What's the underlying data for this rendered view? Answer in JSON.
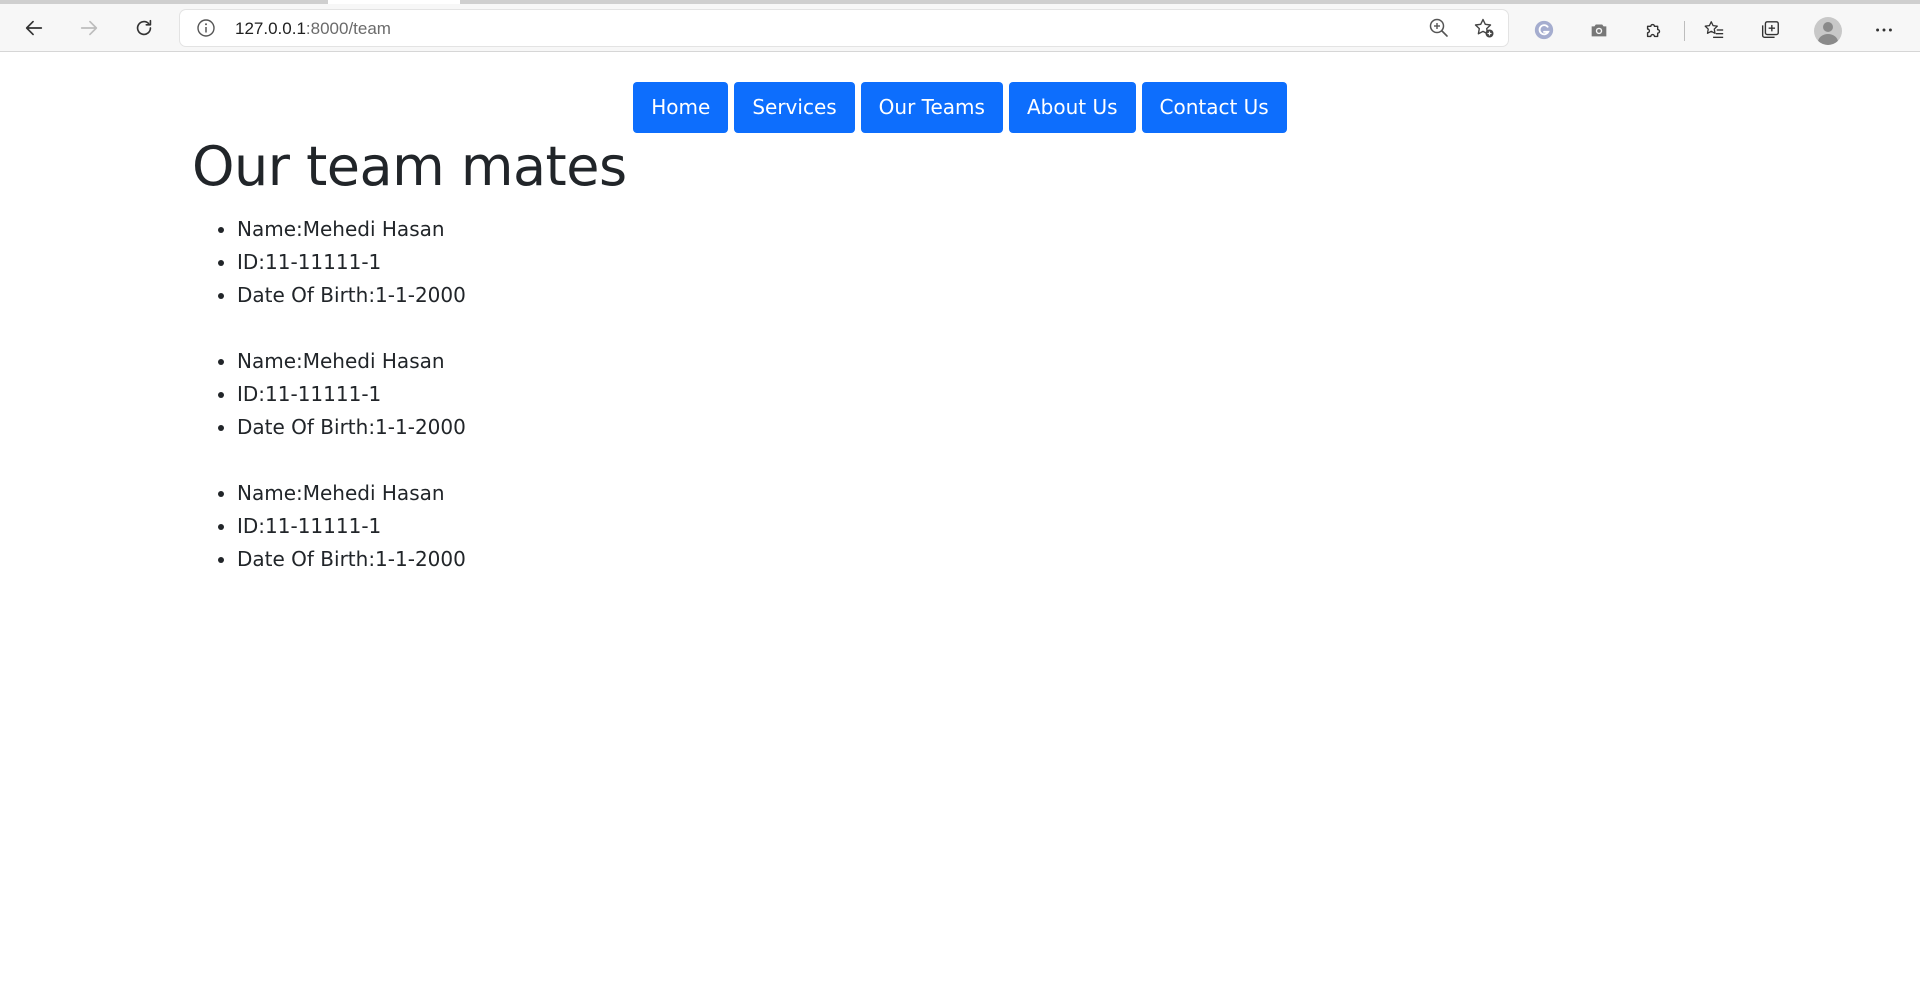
{
  "browser": {
    "url_host": "127.0.0.1",
    "url_rest": ":8000/team",
    "icons": {
      "back": "arrow-left-icon",
      "forward": "arrow-right-icon",
      "reload": "reload-icon",
      "site_info": "info-icon",
      "zoom": "zoom-in-icon",
      "favorite": "add-favorite-icon",
      "grammarly": "grammarly-icon",
      "screenshot": "camera-icon",
      "extensions": "puzzle-icon",
      "favorites": "favorites-list-icon",
      "collections": "collections-icon",
      "profile": "profile-avatar",
      "menu": "more-icon"
    }
  },
  "nav": {
    "items": [
      {
        "label": "Home"
      },
      {
        "label": "Services"
      },
      {
        "label": "Our Teams"
      },
      {
        "label": "About Us"
      },
      {
        "label": "Contact Us"
      }
    ],
    "button_color": "#0d6efd"
  },
  "page": {
    "title": "Our team mates"
  },
  "members": [
    {
      "name": "Name:Mehedi Hasan",
      "id": "ID:11-11111-1",
      "dob": "Date Of Birth:1-1-2000"
    },
    {
      "name": "Name:Mehedi Hasan",
      "id": "ID:11-11111-1",
      "dob": "Date Of Birth:1-1-2000"
    },
    {
      "name": "Name:Mehedi Hasan",
      "id": "ID:11-11111-1",
      "dob": "Date Of Birth:1-1-2000"
    }
  ]
}
